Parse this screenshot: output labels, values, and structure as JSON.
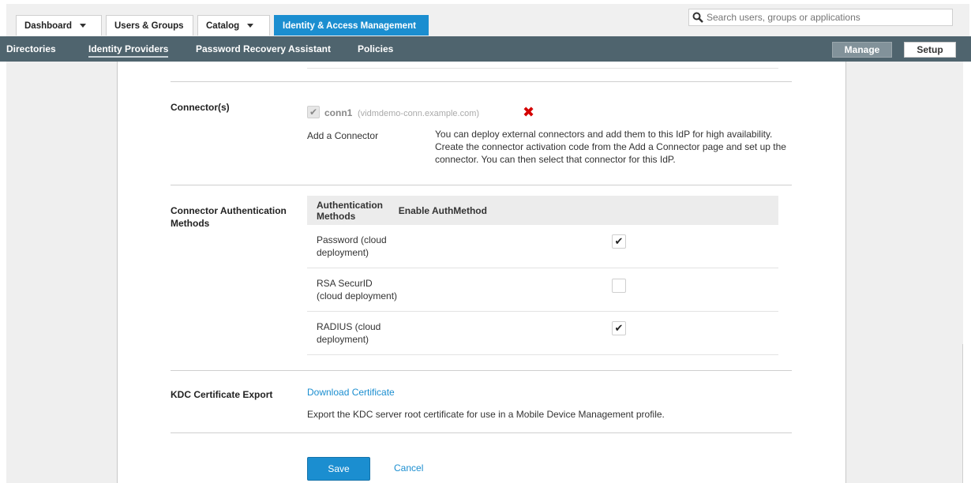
{
  "top_tabs": [
    {
      "label": "Dashboard"
    },
    {
      "label": "Users & Groups"
    },
    {
      "label": "Catalog"
    },
    {
      "label": "Identity & Access Management"
    }
  ],
  "search": {
    "placeholder": "Search users, groups or applications"
  },
  "nav": {
    "items": [
      "Directories",
      "Identity Providers",
      "Password Recovery Assistant",
      "Policies"
    ],
    "manage_label": "Manage",
    "setup_label": "Setup"
  },
  "connectors": {
    "label": "Connector(s)",
    "name": "conn1",
    "host": "(vidmdemo-conn.example.com)",
    "add_link": "Add a Connector",
    "help": "You can deploy external connectors and add them to this IdP for high availability. Create the connector activation code from the Add a Connector page and set up the connector. You can then select that connector for this IdP."
  },
  "auth_methods": {
    "label": "Connector Authentication Methods",
    "col_method": "Authentication Methods",
    "col_enable": "Enable AuthMethod",
    "rows": [
      {
        "name": "Password (cloud deployment)",
        "enabled": true
      },
      {
        "name": "RSA SecurID (cloud deployment)",
        "enabled": false
      },
      {
        "name": "RADIUS (cloud deployment)",
        "enabled": true
      }
    ]
  },
  "kdc": {
    "label": "KDC Certificate Export",
    "link": "Download Certificate",
    "help": "Export the KDC server root certificate for use in a Mobile Device Management profile."
  },
  "actions": {
    "save": "Save",
    "cancel": "Cancel"
  },
  "colors": {
    "accent": "#1b8ed0",
    "nav_bg": "#4f646e",
    "remove": "#d40000"
  }
}
